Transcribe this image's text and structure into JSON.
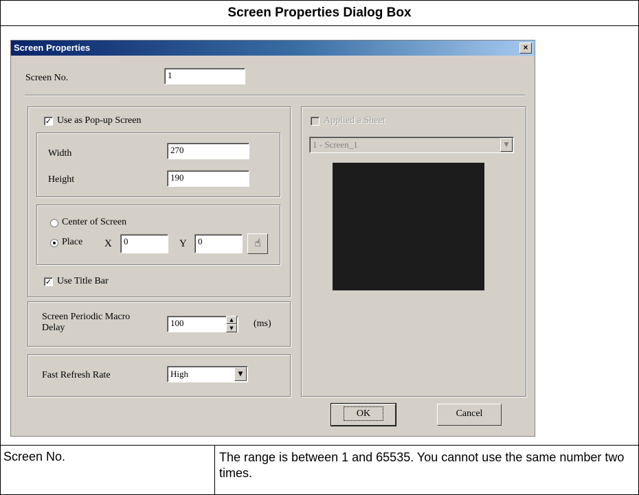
{
  "page": {
    "heading": "Screen Properties Dialog Box",
    "description": {
      "term": "Screen No.",
      "text": "The range is between 1 and 65535. You cannot use the same number two times."
    }
  },
  "dialog": {
    "title": "Screen Properties",
    "close_label": "×",
    "screen_no": {
      "label": "Screen No.",
      "value": "1"
    },
    "popup": {
      "checkbox_label": "Use as Pop-up Screen",
      "checked": true,
      "width": {
        "label": "Width",
        "value": "270"
      },
      "height": {
        "label": "Height",
        "value": "190"
      },
      "position": {
        "center_label": "Center of Screen",
        "place_label": "Place",
        "selected": "place",
        "x_label": "X",
        "x_value": "0",
        "y_label": "Y",
        "y_value": "0"
      },
      "title_bar": {
        "label": "Use Title Bar",
        "checked": true
      }
    },
    "macro_delay": {
      "label_line1": "Screen Periodic Macro",
      "label_line2": "Delay",
      "value": "100",
      "unit": "(ms)"
    },
    "refresh": {
      "label": "Fast Refresh Rate",
      "value": "High"
    },
    "sheet": {
      "checkbox_label": "Applied a Sheet",
      "checked": false,
      "enabled": false,
      "select_value": "1 - Screen_1"
    },
    "buttons": {
      "ok": "OK",
      "cancel": "Cancel"
    }
  },
  "icons": {
    "check": "checkmark-icon",
    "pick": "hand-pointer-icon",
    "combo_arrow": "chevron-down-icon",
    "spin": "spin-arrows-icon"
  }
}
